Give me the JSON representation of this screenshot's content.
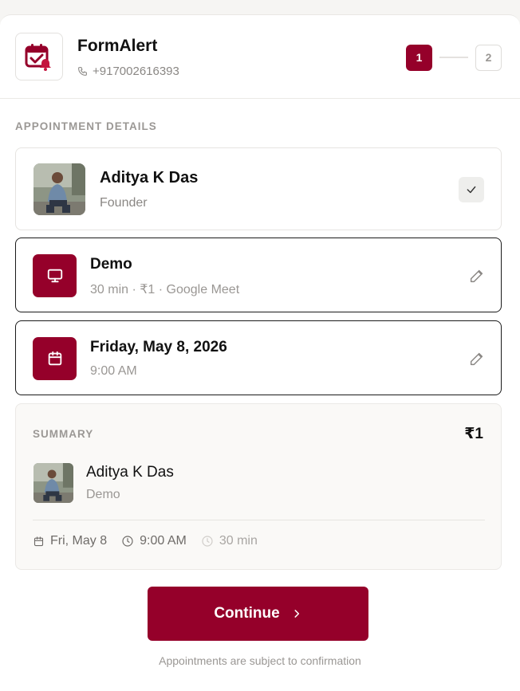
{
  "header": {
    "brand_name": "FormAlert",
    "phone": "+917002616393",
    "steps": [
      "1",
      "2"
    ],
    "active_step": 1
  },
  "appointment": {
    "section_label": "APPOINTMENT DETAILS",
    "host": {
      "name": "Aditya K Das",
      "role": "Founder",
      "selected": true
    },
    "service": {
      "title": "Demo",
      "details": "30 min · ₹1 · Google Meet",
      "icon": "monitor-icon"
    },
    "datetime": {
      "date": "Friday, May 8, 2026",
      "time": "9:00 AM",
      "icon": "calendar-icon"
    }
  },
  "summary": {
    "label": "SUMMARY",
    "price": "₹1",
    "name": "Aditya K Das",
    "service": "Demo",
    "date": "Fri, May 8",
    "time": "9:00 AM",
    "duration": "30 min"
  },
  "actions": {
    "continue_label": "Continue",
    "footnote": "Appointments are subject to confirmation"
  },
  "colors": {
    "accent": "#95002a",
    "background": "#f6f5f3",
    "muted_text": "#9a9794"
  }
}
